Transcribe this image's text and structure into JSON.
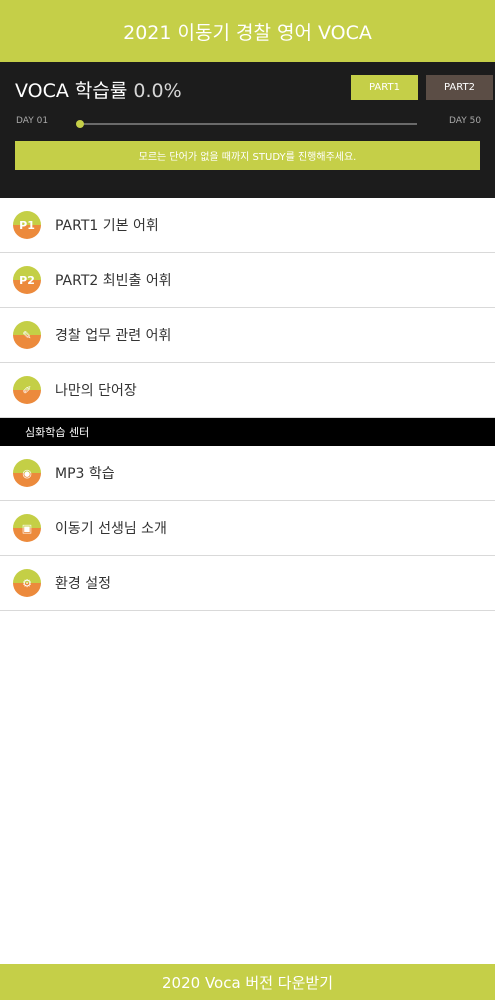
{
  "header": {
    "title": "2021 이동기 경찰 영어 VOCA"
  },
  "progress": {
    "title": "VOCA 학습률",
    "value_text": "0.0%",
    "value": 0.0,
    "part1_label": "PART1",
    "part2_label": "PART2",
    "day_start": "DAY 01",
    "day_end": "DAY 50",
    "notice": "모르는 단어가 없을 때까지 STUDY를 진행해주세요."
  },
  "menu": [
    {
      "label": "PART1 기본 어휘",
      "icon": "p1-badge-icon",
      "glyph": "P1"
    },
    {
      "label": "PART2 최빈출 어휘",
      "icon": "p2-badge-icon",
      "glyph": "P2"
    },
    {
      "label": "경찰 업무 관련 어휘",
      "icon": "pencil-icon",
      "glyph": "✎"
    },
    {
      "label": "나만의 단어장",
      "icon": "notebook-icon",
      "glyph": "✐"
    }
  ],
  "section": {
    "title": "심화학습 센터"
  },
  "menu2": [
    {
      "label": "MP3 학습",
      "icon": "mp3-player-icon",
      "glyph": "◉"
    },
    {
      "label": "이동기 선생님 소개",
      "icon": "teacher-board-icon",
      "glyph": "▣"
    },
    {
      "label": "환경 설정",
      "icon": "gears-icon",
      "glyph": "⚙"
    }
  ],
  "footer": {
    "download_label": "2020 Voca 버전 다운받기"
  },
  "colors": {
    "accent": "#c5cf48",
    "dark": "#1c1c1c",
    "part2": "#5b4d45",
    "icon_bottom": "#ec8a3c"
  }
}
